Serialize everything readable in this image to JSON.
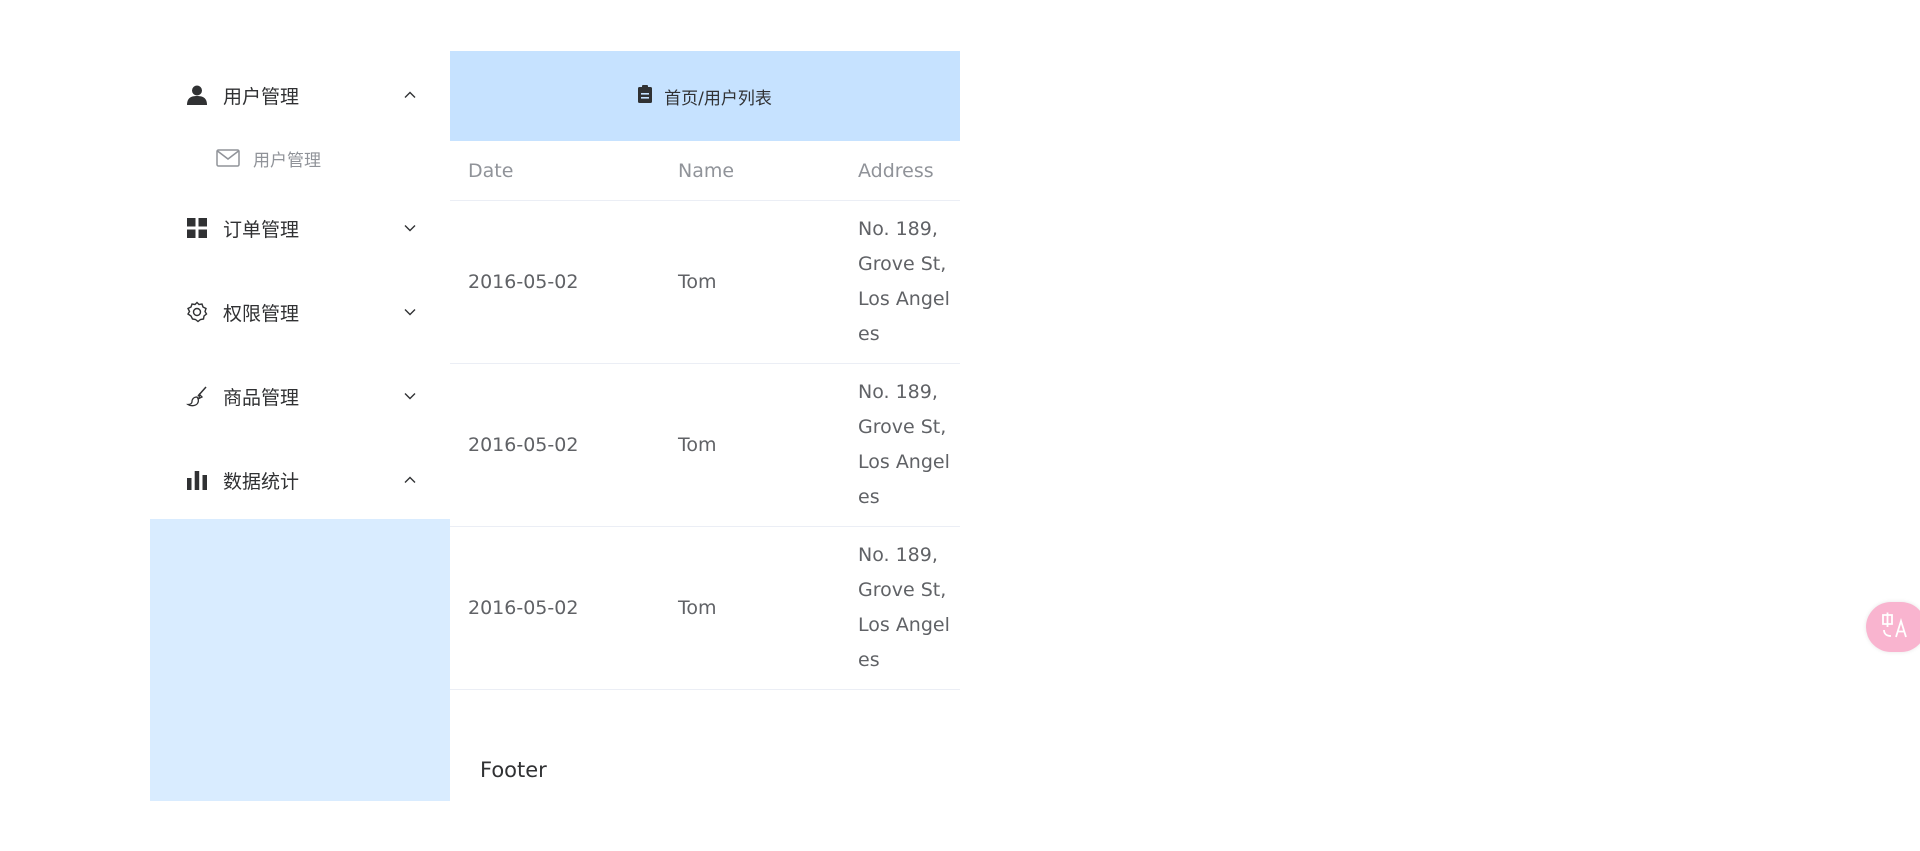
{
  "sidebar": {
    "menus": [
      {
        "label": "用户管理",
        "icon": "user-icon",
        "expanded": true
      },
      {
        "label": "订单管理",
        "icon": "grid-icon",
        "expanded": false
      },
      {
        "label": "权限管理",
        "icon": "gear-icon",
        "expanded": false
      },
      {
        "label": "商品管理",
        "icon": "brush-icon",
        "expanded": false
      },
      {
        "label": "数据统计",
        "icon": "bar-chart-icon",
        "expanded": true
      }
    ],
    "submenu": {
      "label": "用户管理",
      "icon": "mail-icon"
    }
  },
  "header": {
    "breadcrumb": "首页/用户列表",
    "icon": "clipboard-icon"
  },
  "table": {
    "columns": [
      "Date",
      "Name",
      "Address"
    ],
    "rows": [
      {
        "date": "2016-05-02",
        "name": "Tom",
        "address": "No. 189, Grove St, Los Angeles"
      },
      {
        "date": "2016-05-02",
        "name": "Tom",
        "address": "No. 189, Grove St, Los Angeles"
      },
      {
        "date": "2016-05-02",
        "name": "Tom",
        "address": "No. 189, Grove St, Los Angeles"
      }
    ]
  },
  "footer": {
    "label": "Footer"
  },
  "colors": {
    "header_bg": "#c6e2ff",
    "aside_bg": "#d9ecff",
    "fab_bg": "#f9b4cf"
  }
}
